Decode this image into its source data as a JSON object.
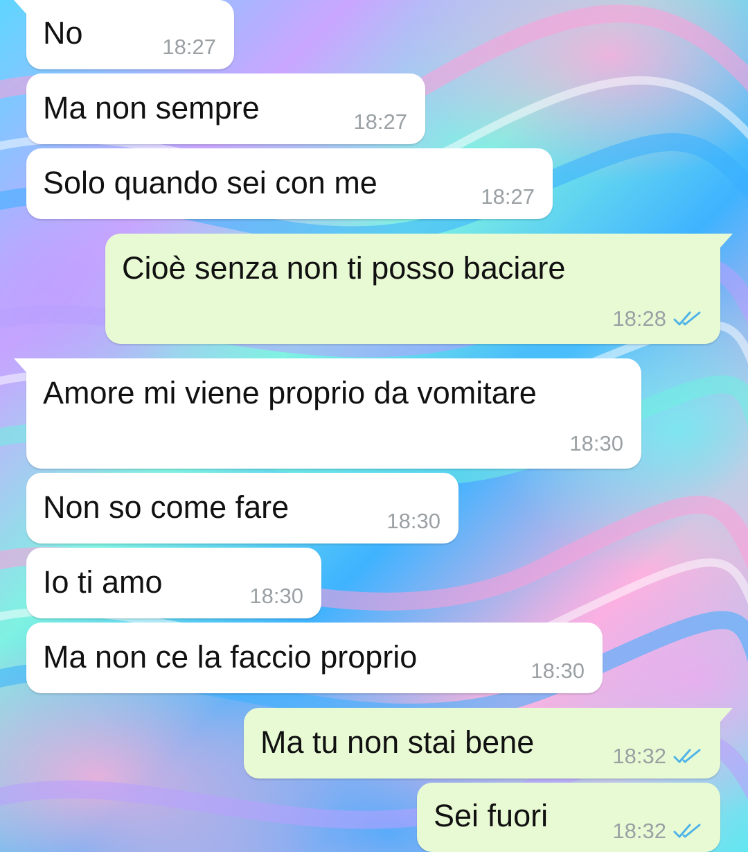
{
  "messages": [
    {
      "direction": "received",
      "text": "No",
      "time": "18:27"
    },
    {
      "direction": "received",
      "text": "Ma non sempre",
      "time": "18:27"
    },
    {
      "direction": "received",
      "text": "Solo quando sei con me",
      "time": "18:27"
    },
    {
      "direction": "sent",
      "text": "Cioè senza non ti posso baciare",
      "time": "18:28",
      "status": "read"
    },
    {
      "direction": "received",
      "text": "Amore mi viene proprio da vomitare",
      "time": "18:30"
    },
    {
      "direction": "received",
      "text": "Non so come fare",
      "time": "18:30"
    },
    {
      "direction": "received",
      "text": "Io ti amo",
      "time": "18:30"
    },
    {
      "direction": "received",
      "text": "Ma non ce la faccio proprio",
      "time": "18:30"
    },
    {
      "direction": "sent",
      "text": "Ma tu non stai bene",
      "time": "18:32",
      "status": "read"
    },
    {
      "direction": "sent",
      "text": "Sei fuori",
      "time": "18:32",
      "status": "read"
    }
  ],
  "colors": {
    "received_bubble": "#ffffff",
    "sent_bubble": "#e8fad4",
    "timestamp": "#9aa0a3",
    "read_ticks": "#4fb3e8"
  },
  "icons": {
    "read_receipt": "double-check-icon"
  }
}
